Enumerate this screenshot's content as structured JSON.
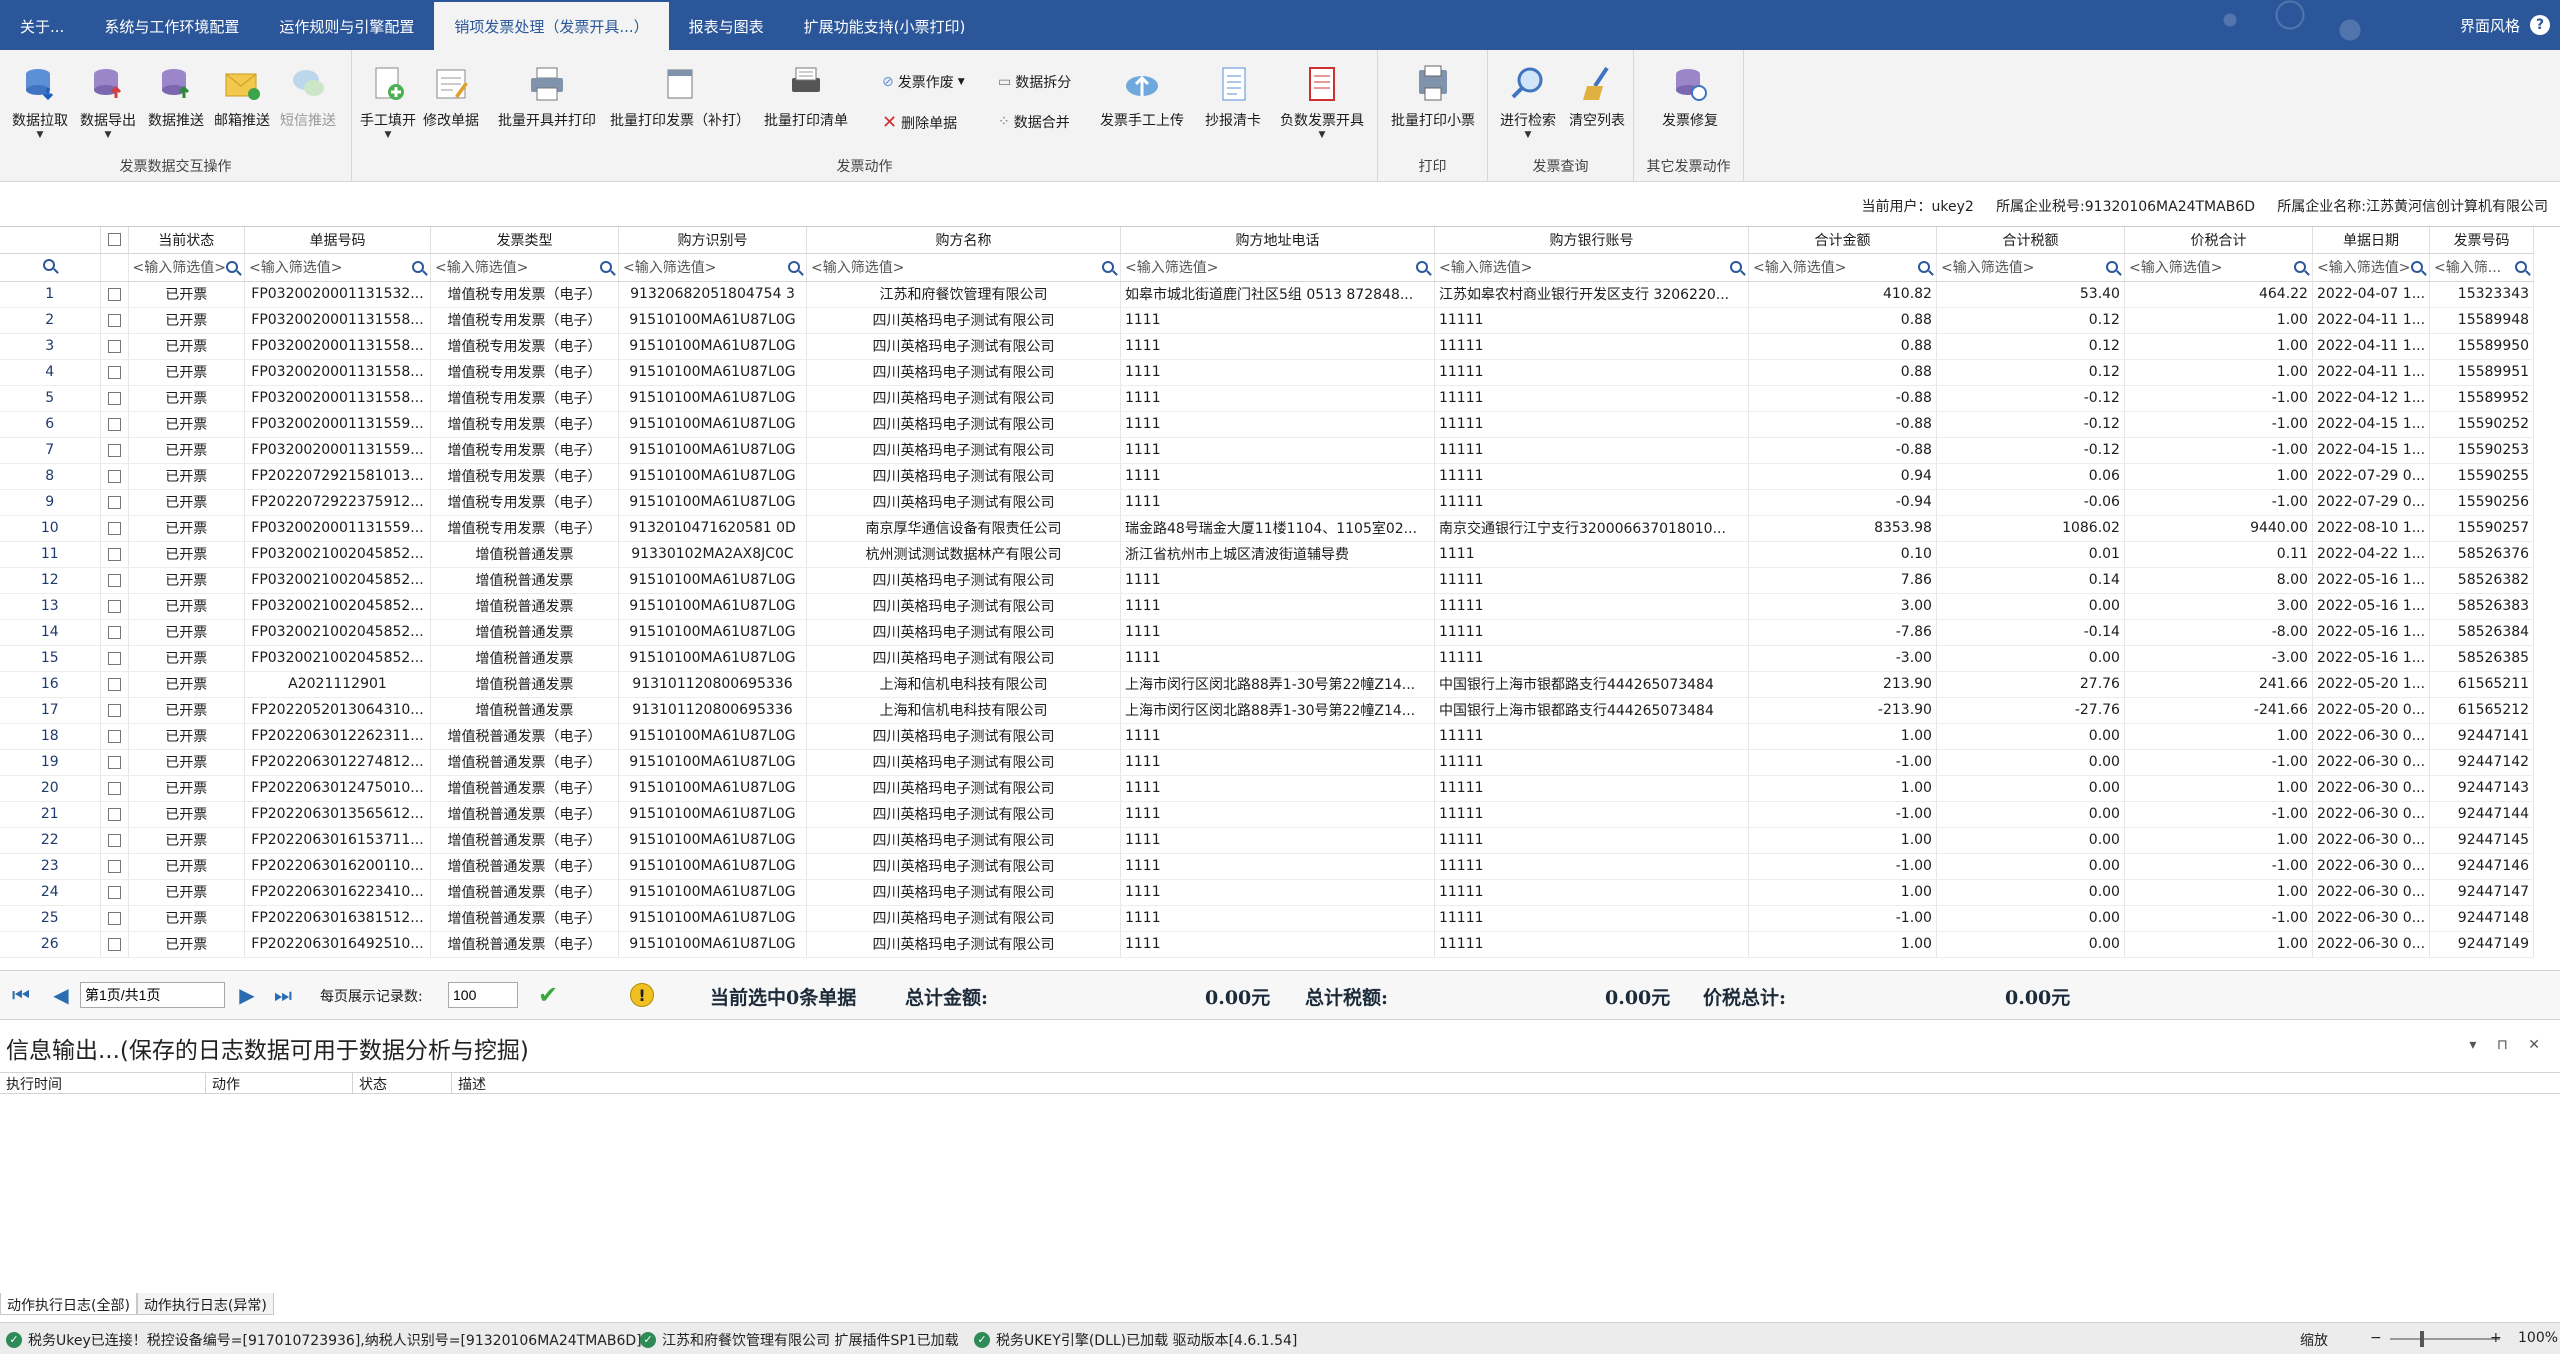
{
  "ribbon_tabs": [
    {
      "label": "关于..."
    },
    {
      "label": "系统与工作环境配置"
    },
    {
      "label": "运作规则与引擎配置"
    },
    {
      "label": "销项发票处理（发票开具...）"
    },
    {
      "label": "报表与图表"
    },
    {
      "label": "扩展功能支持(小票打印)"
    }
  ],
  "active_tab_index": 3,
  "theme_label": "界面风格",
  "help_label": "?",
  "groups": {
    "data_exchange": {
      "label": "发票数据交互操作",
      "buttons": [
        "数据拉取",
        "数据导出",
        "数据推送",
        "邮箱推送",
        "短信推送"
      ]
    },
    "invoice_actions": {
      "label": "发票动作",
      "manual_fill": "手工填开",
      "edit_doc": "修改单据",
      "batch_issue_print": "批量开具并打印",
      "batch_print_invoice": "批量打印发票（补打）",
      "batch_print_list": "批量打印清单",
      "void": "发票作废",
      "delete_doc": "删除单据",
      "split": "数据拆分",
      "merge": "数据合并",
      "manual_upload": "发票手工上传",
      "copy_tax": "抄报清卡",
      "negative_issue": "负数发票开具"
    },
    "print": {
      "label": "打印",
      "batch_ticket": "批量打印小票"
    },
    "query": {
      "label": "发票查询",
      "search": "进行检索",
      "clear": "清空列表"
    },
    "other": {
      "label": "其它发票动作",
      "repair": "发票修复"
    }
  },
  "info": {
    "current_user": "当前用户：ukey2",
    "tax_no": "所属企业税号:91320106MA24TMAB6D",
    "company": "所属企业名称:江苏黄河信创计算机有限公司"
  },
  "columns": [
    "当前状态",
    "单据号码",
    "发票类型",
    "购方识别号",
    "购方名称",
    "购方地址电话",
    "购方银行账号",
    "合计金额",
    "合计税额",
    "价税合计",
    "单据日期",
    "发票号码"
  ],
  "filter_placeholder": "<输入筛选值>",
  "filter_placeholder_short": "<输入筛...",
  "rows": [
    [
      "1",
      "已开票",
      "FP0320020001131532...",
      "增值税专用发票（电子）",
      "91320682051804754 3",
      "江苏和府餐饮管理有限公司",
      "如皋市城北街道鹿门社区5组 0513 872848...",
      "江苏如皋农村商业银行开发区支行 3206220...",
      "410.82",
      "53.40",
      "464.22",
      "2022-04-07 1...",
      "15323343"
    ],
    [
      "2",
      "已开票",
      "FP0320020001131558...",
      "增值税专用发票（电子）",
      "91510100MA61U87L0G",
      "四川英格玛电子测试有限公司",
      "1111",
      "11111",
      "0.88",
      "0.12",
      "1.00",
      "2022-04-11 1...",
      "15589948"
    ],
    [
      "3",
      "已开票",
      "FP0320020001131558...",
      "增值税专用发票（电子）",
      "91510100MA61U87L0G",
      "四川英格玛电子测试有限公司",
      "1111",
      "11111",
      "0.88",
      "0.12",
      "1.00",
      "2022-04-11 1...",
      "15589950"
    ],
    [
      "4",
      "已开票",
      "FP0320020001131558...",
      "增值税专用发票（电子）",
      "91510100MA61U87L0G",
      "四川英格玛电子测试有限公司",
      "1111",
      "11111",
      "0.88",
      "0.12",
      "1.00",
      "2022-04-11 1...",
      "15589951"
    ],
    [
      "5",
      "已开票",
      "FP0320020001131558...",
      "增值税专用发票（电子）",
      "91510100MA61U87L0G",
      "四川英格玛电子测试有限公司",
      "1111",
      "11111",
      "-0.88",
      "-0.12",
      "-1.00",
      "2022-04-12 1...",
      "15589952"
    ],
    [
      "6",
      "已开票",
      "FP0320020001131559...",
      "增值税专用发票（电子）",
      "91510100MA61U87L0G",
      "四川英格玛电子测试有限公司",
      "1111",
      "11111",
      "-0.88",
      "-0.12",
      "-1.00",
      "2022-04-15 1...",
      "15590252"
    ],
    [
      "7",
      "已开票",
      "FP0320020001131559...",
      "增值税专用发票（电子）",
      "91510100MA61U87L0G",
      "四川英格玛电子测试有限公司",
      "1111",
      "11111",
      "-0.88",
      "-0.12",
      "-1.00",
      "2022-04-15 1...",
      "15590253"
    ],
    [
      "8",
      "已开票",
      "FP2022072921581013...",
      "增值税专用发票（电子）",
      "91510100MA61U87L0G",
      "四川英格玛电子测试有限公司",
      "1111",
      "11111",
      "0.94",
      "0.06",
      "1.00",
      "2022-07-29 0...",
      "15590255"
    ],
    [
      "9",
      "已开票",
      "FP2022072922375912...",
      "增值税专用发票（电子）",
      "91510100MA61U87L0G",
      "四川英格玛电子测试有限公司",
      "1111",
      "11111",
      "-0.94",
      "-0.06",
      "-1.00",
      "2022-07-29 0...",
      "15590256"
    ],
    [
      "10",
      "已开票",
      "FP0320020001131559...",
      "增值税专用发票（电子）",
      "9132010471620581 0D",
      "南京厚华通信设备有限责任公司",
      "瑞金路48号瑞金大厦11楼1104、1105室02...",
      "南京交通银行江宁支行320006637018010...",
      "8353.98",
      "1086.02",
      "9440.00",
      "2022-08-10 1...",
      "15590257"
    ],
    [
      "11",
      "已开票",
      "FP0320021002045852...",
      "增值税普通发票",
      "91330102MA2AX8JC0C",
      "杭州测试测试数据林产有限公司",
      "浙江省杭州市上城区清波街道辅导费",
      "1111",
      "0.10",
      "0.01",
      "0.11",
      "2022-04-22 1...",
      "58526376"
    ],
    [
      "12",
      "已开票",
      "FP0320021002045852...",
      "增值税普通发票",
      "91510100MA61U87L0G",
      "四川英格玛电子测试有限公司",
      "1111",
      "11111",
      "7.86",
      "0.14",
      "8.00",
      "2022-05-16 1...",
      "58526382"
    ],
    [
      "13",
      "已开票",
      "FP0320021002045852...",
      "增值税普通发票",
      "91510100MA61U87L0G",
      "四川英格玛电子测试有限公司",
      "1111",
      "11111",
      "3.00",
      "0.00",
      "3.00",
      "2022-05-16 1...",
      "58526383"
    ],
    [
      "14",
      "已开票",
      "FP0320021002045852...",
      "增值税普通发票",
      "91510100MA61U87L0G",
      "四川英格玛电子测试有限公司",
      "1111",
      "11111",
      "-7.86",
      "-0.14",
      "-8.00",
      "2022-05-16 1...",
      "58526384"
    ],
    [
      "15",
      "已开票",
      "FP0320021002045852...",
      "增值税普通发票",
      "91510100MA61U87L0G",
      "四川英格玛电子测试有限公司",
      "1111",
      "11111",
      "-3.00",
      "0.00",
      "-3.00",
      "2022-05-16 1...",
      "58526385"
    ],
    [
      "16",
      "已开票",
      "A2021112901",
      "增值税普通发票",
      "913101120800695336",
      "上海和信机电科技有限公司",
      "上海市闵行区闵北路88弄1-30号第22幢Z14...",
      "中国银行上海市银都路支行444265073484",
      "213.90",
      "27.76",
      "241.66",
      "2022-05-20 1...",
      "61565211"
    ],
    [
      "17",
      "已开票",
      "FP2022052013064310...",
      "增值税普通发票",
      "913101120800695336",
      "上海和信机电科技有限公司",
      "上海市闵行区闵北路88弄1-30号第22幢Z14...",
      "中国银行上海市银都路支行444265073484",
      "-213.90",
      "-27.76",
      "-241.66",
      "2022-05-20 0...",
      "61565212"
    ],
    [
      "18",
      "已开票",
      "FP2022063012262311...",
      "增值税普通发票（电子）",
      "91510100MA61U87L0G",
      "四川英格玛电子测试有限公司",
      "1111",
      "11111",
      "1.00",
      "0.00",
      "1.00",
      "2022-06-30 0...",
      "92447141"
    ],
    [
      "19",
      "已开票",
      "FP2022063012274812...",
      "增值税普通发票（电子）",
      "91510100MA61U87L0G",
      "四川英格玛电子测试有限公司",
      "1111",
      "11111",
      "-1.00",
      "0.00",
      "-1.00",
      "2022-06-30 0...",
      "92447142"
    ],
    [
      "20",
      "已开票",
      "FP2022063012475010...",
      "增值税普通发票（电子）",
      "91510100MA61U87L0G",
      "四川英格玛电子测试有限公司",
      "1111",
      "11111",
      "1.00",
      "0.00",
      "1.00",
      "2022-06-30 0...",
      "92447143"
    ],
    [
      "21",
      "已开票",
      "FP2022063013565612...",
      "增值税普通发票（电子）",
      "91510100MA61U87L0G",
      "四川英格玛电子测试有限公司",
      "1111",
      "11111",
      "-1.00",
      "0.00",
      "-1.00",
      "2022-06-30 0...",
      "92447144"
    ],
    [
      "22",
      "已开票",
      "FP2022063016153711...",
      "增值税普通发票（电子）",
      "91510100MA61U87L0G",
      "四川英格玛电子测试有限公司",
      "1111",
      "11111",
      "1.00",
      "0.00",
      "1.00",
      "2022-06-30 0...",
      "92447145"
    ],
    [
      "23",
      "已开票",
      "FP2022063016200110...",
      "增值税普通发票（电子）",
      "91510100MA61U87L0G",
      "四川英格玛电子测试有限公司",
      "1111",
      "11111",
      "-1.00",
      "0.00",
      "-1.00",
      "2022-06-30 0...",
      "92447146"
    ],
    [
      "24",
      "已开票",
      "FP2022063016223410...",
      "增值税普通发票（电子）",
      "91510100MA61U87L0G",
      "四川英格玛电子测试有限公司",
      "1111",
      "11111",
      "1.00",
      "0.00",
      "1.00",
      "2022-06-30 0...",
      "92447147"
    ],
    [
      "25",
      "已开票",
      "FP2022063016381512...",
      "增值税普通发票（电子）",
      "91510100MA61U87L0G",
      "四川英格玛电子测试有限公司",
      "1111",
      "11111",
      "-1.00",
      "0.00",
      "-1.00",
      "2022-06-30 0...",
      "92447148"
    ],
    [
      "26",
      "已开票",
      "FP2022063016492510...",
      "增值税普通发票（电子）",
      "91510100MA61U87L0G",
      "四川英格玛电子测试有限公司",
      "1111",
      "11111",
      "1.00",
      "0.00",
      "1.00",
      "2022-06-30 0...",
      "92447149"
    ]
  ],
  "pager": {
    "page_text": "第1页/共1页",
    "per_page_label": "每页展示记录数:",
    "per_page_value": "100",
    "selected": "当前选中0条单据",
    "total_amount_label": "总计金额:",
    "total_amount": "0.00元",
    "total_tax_label": "总计税额:",
    "total_tax": "0.00元",
    "total_sum_label": "价税总计:",
    "total_sum": "0.00元"
  },
  "log": {
    "title": "信息输出...(保存的日志数据可用于数据分析与挖掘)",
    "columns": [
      "执行时间",
      "动作",
      "状态",
      "描述"
    ],
    "tabs": [
      "动作执行日志(全部)",
      "动作执行日志(异常)"
    ],
    "controls": "▾ ⊓ ✕"
  },
  "status": {
    "ukey": "税务Ukey已连接！税控设备编号=[917010723936],纳税人识别号=[91320106MA24TMAB6D]",
    "plugin": "江苏和府餐饮管理有限公司 扩展插件SP1已加载",
    "engine": "税务UKEY引擎(DLL)已加载 驱动版本[4.6.1.54]",
    "zoom_label": "缩放",
    "zoom": "100%"
  }
}
